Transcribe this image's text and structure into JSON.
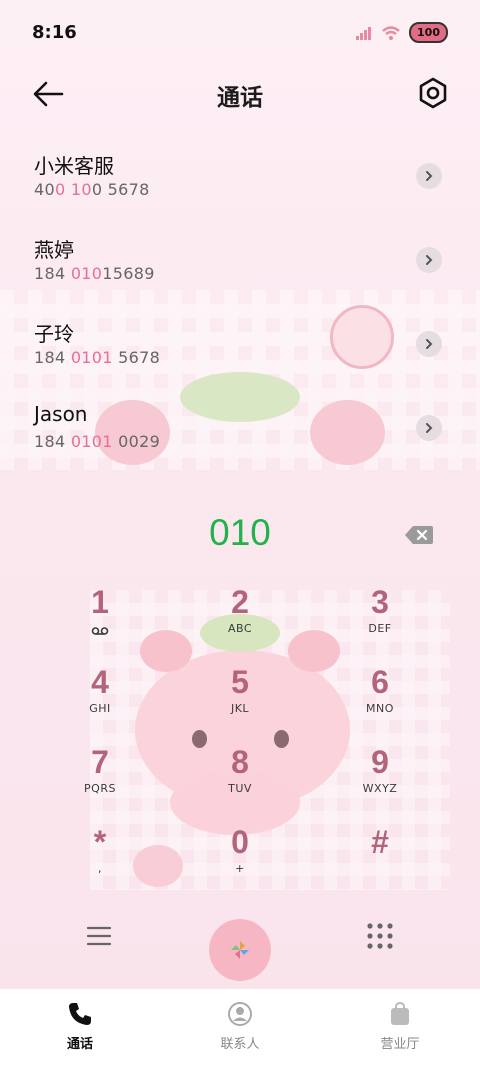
{
  "status_bar": {
    "time": "8:16",
    "battery": "100"
  },
  "header": {
    "title": "通话",
    "back_icon": "arrow-left-icon",
    "settings_icon": "settings-icon"
  },
  "calls": [
    {
      "name": "小米客服",
      "number_parts": [
        "40",
        "0",
        " ",
        "10",
        "0 5678"
      ]
    },
    {
      "name": "燕婷",
      "number_parts": [
        "184 ",
        "010",
        "",
        "",
        "15689"
      ]
    },
    {
      "name": "子玲",
      "number_parts": [
        "184 ",
        "0101",
        "",
        "",
        " 5678"
      ]
    },
    {
      "name": "Jason",
      "number_parts": [
        "184 ",
        "0101",
        "",
        "",
        " 0029"
      ]
    }
  ],
  "dialer": {
    "input": "010",
    "keys": [
      {
        "digit": "1",
        "letters": "voicemail-icon"
      },
      {
        "digit": "2",
        "letters": "ABC"
      },
      {
        "digit": "3",
        "letters": "DEF"
      },
      {
        "digit": "4",
        "letters": "GHI"
      },
      {
        "digit": "5",
        "letters": "JKL"
      },
      {
        "digit": "6",
        "letters": "MNO"
      },
      {
        "digit": "7",
        "letters": "PQRS"
      },
      {
        "digit": "8",
        "letters": "TUV"
      },
      {
        "digit": "9",
        "letters": "WXYZ"
      },
      {
        "digit": "*",
        "letters": ","
      },
      {
        "digit": "0",
        "letters": "+"
      },
      {
        "digit": "#",
        "letters": ""
      }
    ]
  },
  "bottom_nav": [
    {
      "label": "通话",
      "icon": "phone-icon",
      "active": true
    },
    {
      "label": "联系人",
      "icon": "contact-icon",
      "active": false
    },
    {
      "label": "营业厅",
      "icon": "shopping-bag-icon",
      "active": false
    }
  ],
  "colors": {
    "accent": "#e86e94",
    "dial_green": "#22b14c",
    "key_digit": "#b4647a",
    "call_button": "#f6b6c3"
  }
}
